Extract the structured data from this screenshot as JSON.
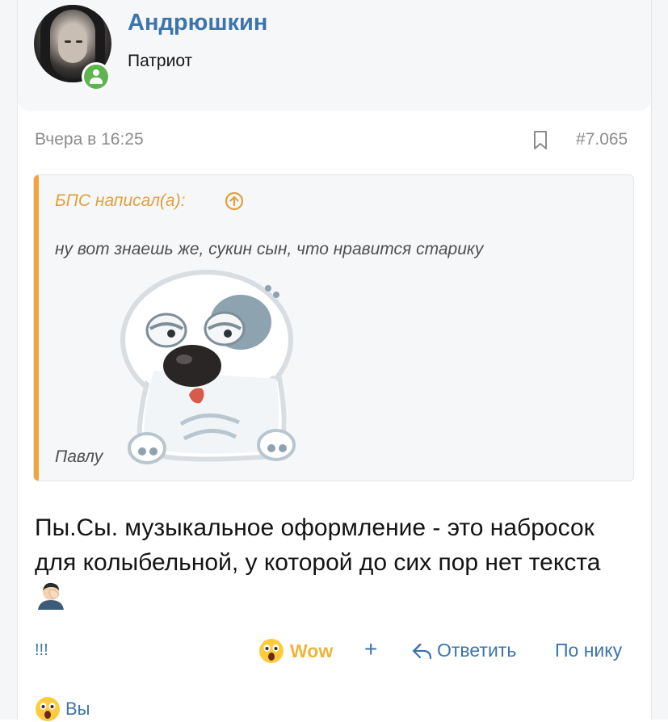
{
  "user": {
    "name": "Андрюшкин",
    "title": "Патриот"
  },
  "post": {
    "date": "Вчера в 16:25",
    "number": "#7.065",
    "quote": {
      "author": "БПС написал(а):",
      "text": "ну вот знаешь же, сукин сын, что нравится старику",
      "sign": "Павлу"
    },
    "body": "Пы.Сы. музыкальное оформление - это набросок для колыбельной, у которой до сих пор нет текста"
  },
  "actions": {
    "report": "!!!",
    "wow": "Wow",
    "add": "+",
    "reply": "Ответить",
    "nick": "По нику"
  },
  "reactions": {
    "summary": "Вы"
  },
  "colors": {
    "link": "#3c74ac",
    "quote_accent": "#f0a43a",
    "online": "#5fb450",
    "wow": "#f0b43c"
  }
}
